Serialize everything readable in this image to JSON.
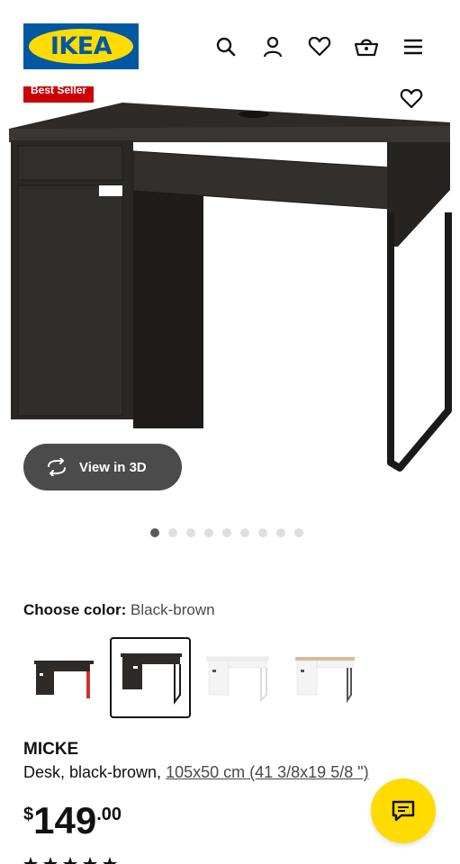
{
  "header": {
    "logo_text": "IKEA",
    "icons": [
      "search-icon",
      "account-icon",
      "heart-icon",
      "basket-icon",
      "menu-icon"
    ]
  },
  "hero": {
    "badge_label": "Best Seller",
    "view_3d_label": "View in 3D",
    "image_count": 9,
    "active_image_index": 0
  },
  "color_picker": {
    "label": "Choose color:",
    "selected_value": "Black-brown",
    "selected_index": 1
  },
  "product": {
    "name": "MICKE",
    "description": "Desk, black-brown,",
    "dimensions": "105x50 cm (41 3/8x19 5/8 \")",
    "price": {
      "currency": "$",
      "integer": "149",
      "decimal": ".00"
    }
  },
  "colors": {
    "brand_blue": "#0058a3",
    "brand_yellow": "#ffdb00",
    "badge_red": "#cc0008"
  }
}
